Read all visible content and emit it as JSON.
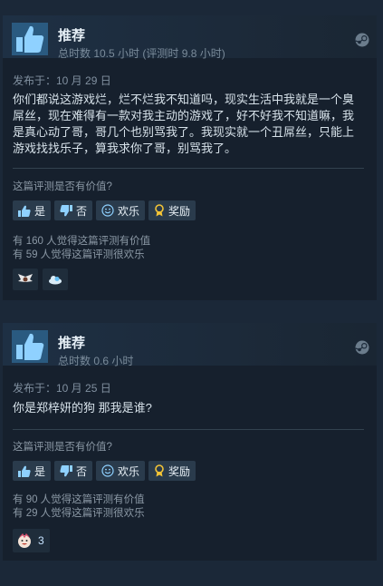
{
  "reviews": [
    {
      "recommend_label": "推荐",
      "hours": "总时数 10.5 小时   (评测时 9.8 小时)",
      "date": "发布于：10 月 29 日",
      "text": "你们都说这游戏烂，烂不烂我不知道吗，现实生活中我就是一个臭屌丝，现在难得有一款对我主动的游戏了，好不好我不知道嘛，我是真心动了哥，哥几个也别骂我了。我现实就一个丑屌丝，只能上游戏找找乐子，算我求你了哥，别骂我了。",
      "helpful_question": "这篇评测是否有价值?",
      "buttons": {
        "yes": "是",
        "no": "否",
        "funny": "欢乐",
        "award": "奖励"
      },
      "helpful_count": "有 160 人觉得这篇评测有价值",
      "funny_count": "有 59 人觉得这篇评测很欢乐",
      "awards": [
        {
          "icon": "winged-award-icon",
          "count": ""
        },
        {
          "icon": "cloud-award-icon",
          "count": ""
        }
      ]
    },
    {
      "recommend_label": "推荐",
      "hours": "总时数 0.6 小时",
      "date": "发布于：10 月 25 日",
      "text": "你是郑梓妍的狗 那我是谁?",
      "helpful_question": "这篇评测是否有价值?",
      "buttons": {
        "yes": "是",
        "no": "否",
        "funny": "欢乐",
        "award": "奖励"
      },
      "helpful_count": "有 90 人觉得这篇评测有价值",
      "funny_count": "有 29 人觉得这篇评测很欢乐",
      "awards": [
        {
          "icon": "laughing-face-award-icon",
          "count": "3"
        }
      ]
    }
  ],
  "colors": {
    "accent": "#66c0f4",
    "background": "#1b2838",
    "card": "#16202d"
  }
}
